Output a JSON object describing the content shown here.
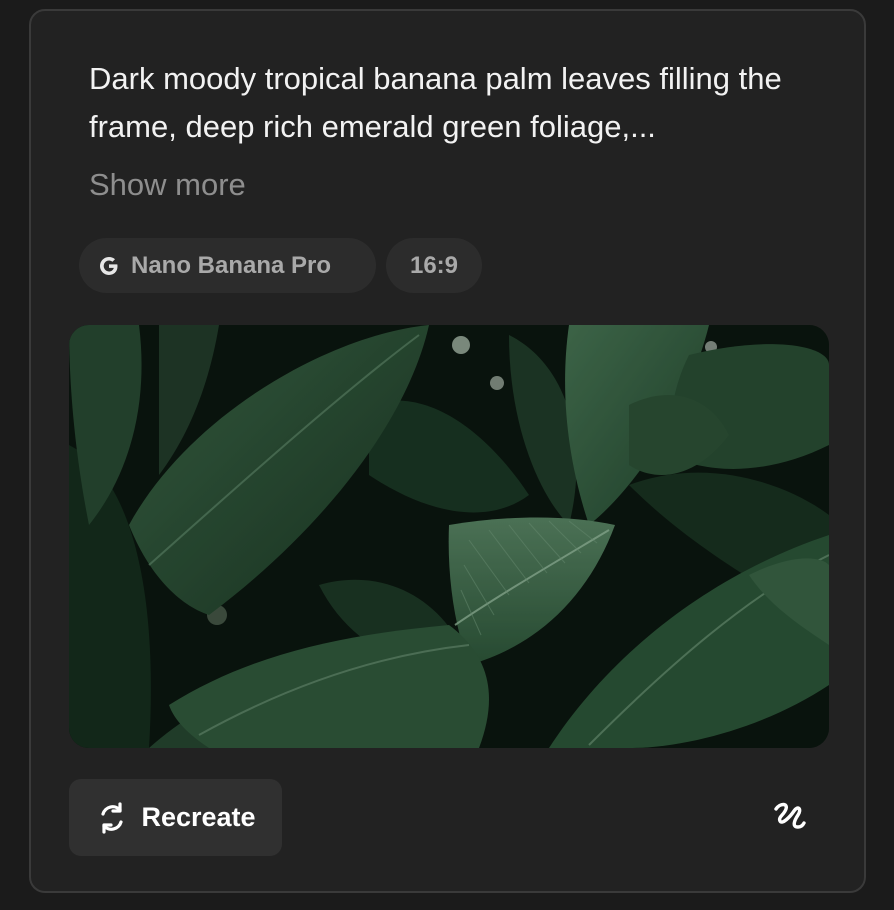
{
  "prompt": {
    "text": "Dark moody tropical banana palm leaves filling the frame, deep rich emerald green foliage,...",
    "show_more_label": "Show more"
  },
  "tags": {
    "model_label": "Nano Banana Pro",
    "model_icon": "google-g-icon",
    "aspect_ratio": "16:9"
  },
  "image": {
    "alt": "Dark moody tropical banana palm leaves filling the frame, deep rich emerald green foliage"
  },
  "actions": {
    "recreate_label": "Recreate",
    "recreate_icon": "refresh-icon",
    "remix_icon": "squiggle-icon"
  },
  "colors": {
    "background": "#1b1b1b",
    "card": "#222222",
    "border": "#3a3a3a",
    "chip": "#2c2c2c",
    "button": "#303030",
    "text_primary": "#f2f2f2",
    "text_muted": "#8e8e8e"
  }
}
